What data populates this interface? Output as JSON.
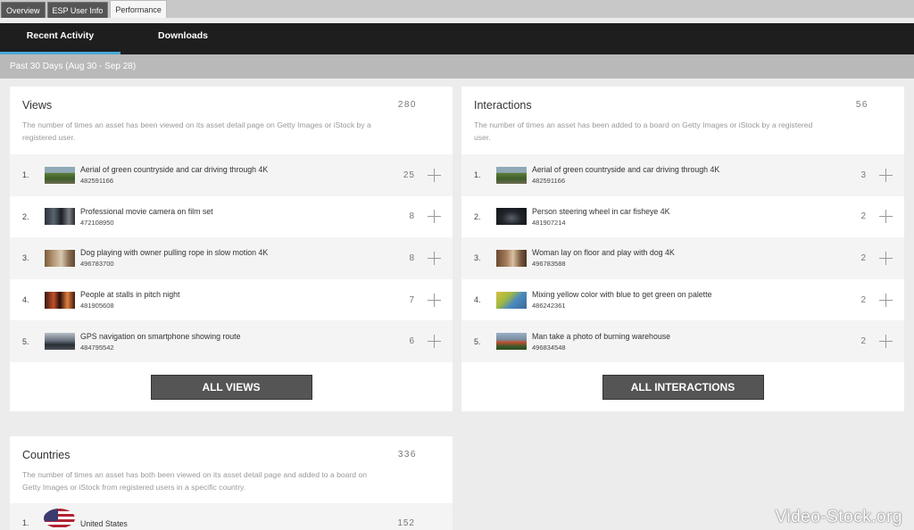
{
  "top_tabs": [
    "Overview",
    "ESP User Info",
    "Performance"
  ],
  "nav": {
    "recent_activity": "Recent Activity",
    "downloads": "Downloads"
  },
  "date_range": "Past 30 Days (Aug 30 - Sep 28)",
  "views": {
    "title": "Views",
    "total": "280",
    "description": "The number of times an asset has been viewed on its asset detail page on Getty Images or iStock by a registered user.",
    "items": [
      {
        "rank": "1.",
        "title": "Aerial of green countryside and car driving through 4K",
        "id": "482591166",
        "count": "25"
      },
      {
        "rank": "2.",
        "title": "Professional movie camera on film set",
        "id": "472108950",
        "count": "8"
      },
      {
        "rank": "3.",
        "title": "Dog playing with owner pulling rope in slow motion 4K",
        "id": "496783700",
        "count": "8"
      },
      {
        "rank": "4.",
        "title": "People at stalls in pitch night",
        "id": "481905608",
        "count": "7"
      },
      {
        "rank": "5.",
        "title": "GPS navigation on smartphone showing route",
        "id": "484795542",
        "count": "6"
      }
    ],
    "button": "ALL VIEWS"
  },
  "interactions": {
    "title": "Interactions",
    "total": "56",
    "description": "The number of times an asset has been added to a board on Getty Images or iStock by a registered user.",
    "items": [
      {
        "rank": "1.",
        "title": "Aerial of green countryside and car driving through 4K",
        "id": "482591166",
        "count": "3"
      },
      {
        "rank": "2.",
        "title": "Person steering wheel in car fisheye 4K",
        "id": "481907214",
        "count": "2"
      },
      {
        "rank": "3.",
        "title": "Woman lay on floor and play with dog 4K",
        "id": "496783588",
        "count": "2"
      },
      {
        "rank": "4.",
        "title": "Mixing yellow color with blue to get green on palette",
        "id": "486242361",
        "count": "2"
      },
      {
        "rank": "5.",
        "title": "Man take a photo of burning warehouse",
        "id": "496834548",
        "count": "2"
      }
    ],
    "button": "ALL INTERACTIONS"
  },
  "countries": {
    "title": "Countries",
    "total": "336",
    "description": "The number of times an asset has both been viewed on its asset detail page and added to a board on Getty Images or iStock from registered users in a specific country.",
    "items": [
      {
        "rank": "1.",
        "name": "United States",
        "count": "152"
      }
    ]
  },
  "watermark": "Video-Stock.org"
}
